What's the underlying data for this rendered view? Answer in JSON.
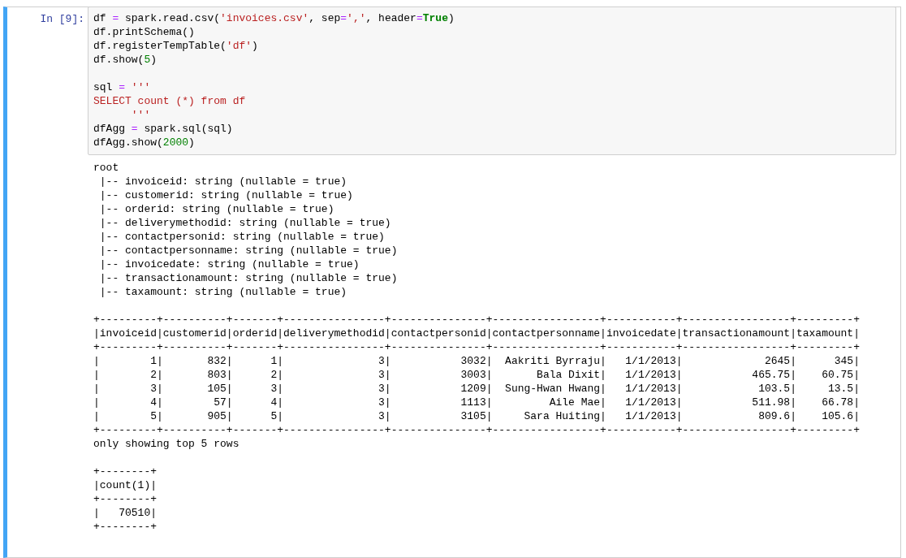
{
  "cell": {
    "prompt": "In [9]:",
    "code_blocks": [
      [
        {
          "tokens": [
            {
              "text": "df ",
              "kind": "plain"
            },
            {
              "text": "=",
              "kind": "op"
            },
            {
              "text": " spark.read.csv(",
              "kind": "plain"
            },
            {
              "text": "'invoices.csv'",
              "kind": "string"
            },
            {
              "text": ", sep",
              "kind": "plain"
            },
            {
              "text": "=",
              "kind": "op"
            },
            {
              "text": "','",
              "kind": "string"
            },
            {
              "text": ", header",
              "kind": "plain"
            },
            {
              "text": "=",
              "kind": "op"
            },
            {
              "text": "True",
              "kind": "keyword"
            },
            {
              "text": ")",
              "kind": "plain"
            }
          ]
        },
        {
          "tokens": [
            {
              "text": "df.printSchema()",
              "kind": "plain"
            }
          ]
        },
        {
          "tokens": [
            {
              "text": "df.registerTempTable(",
              "kind": "plain"
            },
            {
              "text": "'df'",
              "kind": "string"
            },
            {
              "text": ")",
              "kind": "plain"
            }
          ]
        },
        {
          "tokens": [
            {
              "text": "df.show(",
              "kind": "plain"
            },
            {
              "text": "5",
              "kind": "number"
            },
            {
              "text": ")",
              "kind": "plain"
            }
          ]
        }
      ],
      [
        {
          "tokens": [
            {
              "text": "sql ",
              "kind": "plain"
            },
            {
              "text": "=",
              "kind": "op"
            },
            {
              "text": " '''",
              "kind": "string"
            }
          ]
        },
        {
          "tokens": [
            {
              "text": "SELECT count (*) from df",
              "kind": "string"
            }
          ]
        },
        {
          "tokens": [
            {
              "text": "      '''",
              "kind": "string"
            }
          ]
        },
        {
          "tokens": [
            {
              "text": "dfAgg ",
              "kind": "plain"
            },
            {
              "text": "=",
              "kind": "op"
            },
            {
              "text": " spark.sql(sql)",
              "kind": "plain"
            }
          ]
        },
        {
          "tokens": [
            {
              "text": "dfAgg.show(",
              "kind": "plain"
            },
            {
              "text": "2000",
              "kind": "number"
            },
            {
              "text": ")",
              "kind": "plain"
            }
          ]
        }
      ]
    ],
    "output_blocks": [
      [
        "root",
        " |-- invoiceid: string (nullable = true)",
        " |-- customerid: string (nullable = true)",
        " |-- orderid: string (nullable = true)",
        " |-- deliverymethodid: string (nullable = true)",
        " |-- contactpersonid: string (nullable = true)",
        " |-- contactpersonname: string (nullable = true)",
        " |-- invoicedate: string (nullable = true)",
        " |-- transactionamount: string (nullable = true)",
        " |-- taxamount: string (nullable = true)"
      ],
      [
        "+---------+----------+-------+----------------+---------------+-----------------+-----------+-----------------+---------+",
        "|invoiceid|customerid|orderid|deliverymethodid|contactpersonid|contactpersonname|invoicedate|transactionamount|taxamount|",
        "+---------+----------+-------+----------------+---------------+-----------------+-----------+-----------------+---------+",
        "|        1|       832|      1|               3|           3032|  Aakriti Byrraju|   1/1/2013|             2645|      345|",
        "|        2|       803|      2|               3|           3003|       Bala Dixit|   1/1/2013|           465.75|    60.75|",
        "|        3|       105|      3|               3|           1209|  Sung-Hwan Hwang|   1/1/2013|            103.5|     13.5|",
        "|        4|        57|      4|               3|           1113|         Aile Mae|   1/1/2013|           511.98|    66.78|",
        "|        5|       905|      5|               3|           3105|     Sara Huiting|   1/1/2013|            809.6|    105.6|",
        "+---------+----------+-------+----------------+---------------+-----------------+-----------+-----------------+---------+",
        "only showing top 5 rows"
      ],
      [
        "+--------+",
        "|count(1)|",
        "+--------+",
        "|   70510|",
        "+--------+"
      ]
    ]
  }
}
